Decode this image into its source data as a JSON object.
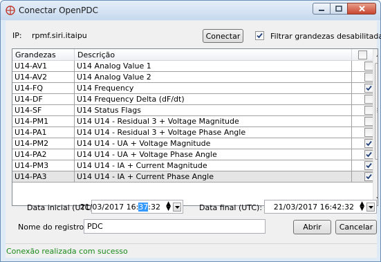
{
  "window": {
    "title": "Conectar OpenPDC"
  },
  "connection": {
    "ip_label": "IP:",
    "ip_value": "rpmf.siri.itaipu",
    "connect_label": "Conectar",
    "filter_checked": true,
    "filter_label": "Filtrar grandezas desabilitadas"
  },
  "grid": {
    "headers": [
      "Grandezas",
      "Descrição"
    ],
    "header_checked": false,
    "rows": [
      {
        "name": "U14-AV1",
        "desc": "U14 Analog Value 1",
        "checked": false
      },
      {
        "name": "U14-AV2",
        "desc": "U14 Analog Value 2",
        "checked": false
      },
      {
        "name": "U14-FQ",
        "desc": "U14 Frequency",
        "checked": true
      },
      {
        "name": "U14-DF",
        "desc": "U14 Frequency Delta (dF/dt)",
        "checked": false
      },
      {
        "name": "U14-SF",
        "desc": "U14 Status Flags",
        "checked": false
      },
      {
        "name": "U14-PM1",
        "desc": "U14 U14 - Residual 3  + Voltage Magnitude",
        "checked": false
      },
      {
        "name": "U14-PA1",
        "desc": "U14 U14 - Residual 3  + Voltage Phase Angle",
        "checked": false
      },
      {
        "name": "U14-PM2",
        "desc": "U14 U14 - UA  + Voltage Magnitude",
        "checked": true
      },
      {
        "name": "U14-PA2",
        "desc": "U14 U14 - UA  + Voltage Phase Angle",
        "checked": true
      },
      {
        "name": "U14-PM3",
        "desc": "U14 U14 - IA  + Current Magnitude",
        "checked": true
      },
      {
        "name": "U14-PA3",
        "desc": "U14 U14 - IA  + Current Phase Angle",
        "checked": true
      }
    ]
  },
  "dates": {
    "start_label": "Data inicial (UTC):",
    "start_before": "21/03/2017 16:",
    "start_selected": "37",
    "start_after": ":32",
    "end_label": "Data final (UTC):",
    "end_value": "21/03/2017 16:42:32"
  },
  "record": {
    "name_label": "Nome do registro:",
    "name_value": "PDC",
    "open_label": "Abrir",
    "cancel_label": "Cancelar"
  },
  "status": {
    "text": "Conexão realizada com sucesso",
    "color": "#1a8a1a"
  }
}
